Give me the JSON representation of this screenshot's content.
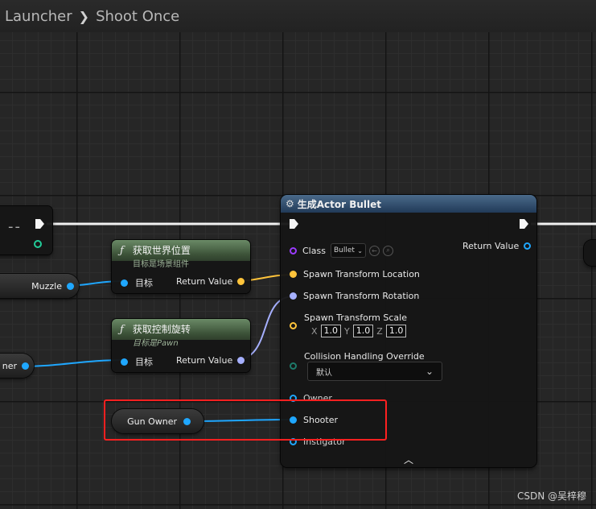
{
  "breadcrumb": {
    "parent": "Launcher",
    "current": "Shoot Once"
  },
  "left_node": {
    "label": "--"
  },
  "muzzle_var": {
    "label": "Muzzle"
  },
  "owner_var": {
    "label": "ner"
  },
  "gun_owner_var": {
    "label": "Gun Owner"
  },
  "get_world_location": {
    "title": "获取世界位置",
    "subtitle": "目标是场景组件",
    "target_label": "目标",
    "return_label": "Return Value"
  },
  "get_control_rotation": {
    "title": "获取控制旋转",
    "subtitle": "目标是Pawn",
    "target_label": "目标",
    "return_label": "Return Value"
  },
  "spawn_actor": {
    "title": "生成Actor Bullet",
    "class_label": "Class",
    "class_value": "Bullet",
    "return_label": "Return Value",
    "spawn_location_label": "Spawn Transform Location",
    "spawn_rotation_label": "Spawn Transform Rotation",
    "spawn_scale_label": "Spawn Transform Scale",
    "scale": {
      "x_label": "X",
      "x": "1.0",
      "y_label": "Y",
      "y": "1.0",
      "z_label": "Z",
      "z": "1.0"
    },
    "collision_label": "Collision Handling Override",
    "collision_value": "默认",
    "owner_label": "Owner",
    "shooter_label": "Shooter",
    "instigator_label": "Instigator"
  },
  "watermark": "CSDN @吴梓穆",
  "colors": {
    "object_pin": "#1fa7ff",
    "vector_pin": "#ffc43b",
    "rotator_pin": "#a6b0ff",
    "function_header": "#4a6646",
    "spawn_header": "#2d4a6a",
    "highlight": "#ff2020"
  }
}
